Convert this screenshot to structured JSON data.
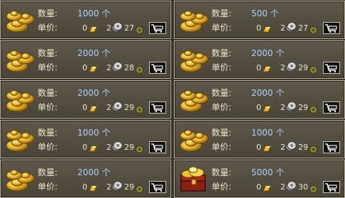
{
  "labels": {
    "quantity": "数量:",
    "price": "单价:"
  },
  "items": [
    {
      "quantity": "1000 个",
      "gold": "0",
      "silver": "2",
      "coin": "27"
    },
    {
      "quantity": "500 个",
      "gold": "0",
      "silver": "2",
      "coin": "27"
    },
    {
      "quantity": "2000 个",
      "gold": "0",
      "silver": "2",
      "coin": "28"
    },
    {
      "quantity": "2000 个",
      "gold": "0",
      "silver": "2",
      "coin": "29"
    },
    {
      "quantity": "2000 个",
      "gold": "0",
      "silver": "2",
      "coin": "29"
    },
    {
      "quantity": "2000 个",
      "gold": "0",
      "silver": "2",
      "coin": "29"
    },
    {
      "quantity": "1000 个",
      "gold": "0",
      "silver": "2",
      "coin": "29"
    },
    {
      "quantity": "1000 个",
      "gold": "0",
      "silver": "2",
      "coin": "29"
    },
    {
      "quantity": "2000 个",
      "gold": "0",
      "silver": "2",
      "coin": "29"
    },
    {
      "quantity": "5000 个",
      "gold": "0",
      "silver": "2",
      "coin": "30"
    }
  ],
  "icons": {
    "item": "gold-ingot-icon",
    "last_item": "treasure-chest-icon",
    "gold": "gold-bar-icon",
    "silver": "silver-coin-icon",
    "coin": "copper-coin-icon",
    "buy": "shopping-cart-icon"
  },
  "colors": {
    "quantity_text": "#a9d3ff",
    "label_text": "#f2e6c8"
  }
}
